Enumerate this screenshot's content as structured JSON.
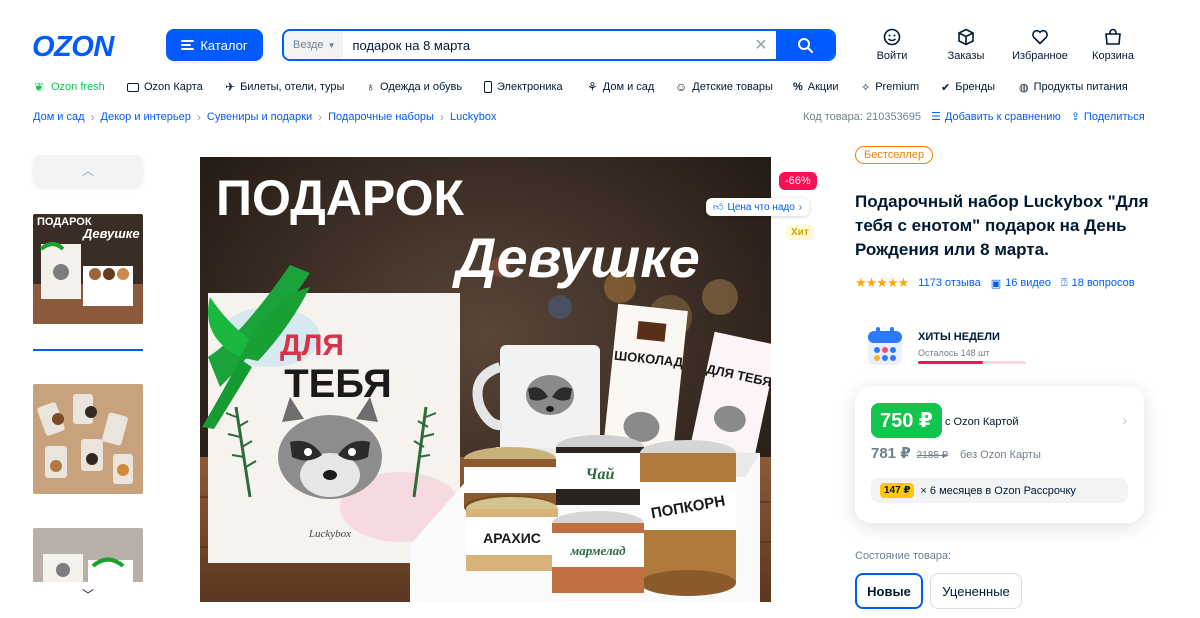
{
  "brand": {
    "logo": "OZON",
    "color": "#005bff"
  },
  "header": {
    "catalog_label": "Каталог",
    "search": {
      "scope": "Везде",
      "query": "подарок на 8 марта"
    },
    "icons": [
      {
        "name": "login-icon",
        "label": "Войти"
      },
      {
        "name": "orders-icon",
        "label": "Заказы"
      },
      {
        "name": "favorites-icon",
        "label": "Избранное"
      },
      {
        "name": "cart-icon",
        "label": "Корзина"
      }
    ]
  },
  "nav": [
    {
      "label": "Ozon fresh",
      "icon": "fresh-icon"
    },
    {
      "label": "Ozon Карта",
      "icon": "card-icon"
    },
    {
      "label": "Билеты, отели, туры",
      "icon": "plane-icon"
    },
    {
      "label": "Одежда и обувь",
      "icon": "clothes-icon"
    },
    {
      "label": "Электроника",
      "icon": "phone-icon"
    },
    {
      "label": "Дом и сад",
      "icon": "plant-icon"
    },
    {
      "label": "Детские товары",
      "icon": "kids-icon"
    },
    {
      "label": "Акции",
      "icon": "percent-icon"
    },
    {
      "label": "Premium",
      "icon": "premium-icon"
    },
    {
      "label": "Бренды",
      "icon": "brands-icon"
    },
    {
      "label": "Продукты питания",
      "icon": "food-icon"
    }
  ],
  "breadcrumbs": [
    "Дом и сад",
    "Декор и интерьер",
    "Сувениры и подарки",
    "Подарочные наборы",
    "Luckybox"
  ],
  "meta": {
    "code": "Код товара: 210353695",
    "compare": "Добавить к сравнению",
    "share": "Поделиться"
  },
  "image": {
    "headline_1": "ПОДАРОК",
    "headline_2": "Девушке",
    "box_1": "ДЛЯ",
    "box_2": "ТЕБЯ",
    "box_brand": "Luckybox",
    "jar_1": "ПОПКОРН",
    "jar_2": "Чай",
    "jar_3": "АРАХИС",
    "jar_4": "мармелад",
    "pack_1": "ШОКОЛАД",
    "pack_2": "ДЛЯ ТЕБЯ",
    "thumb_text_1": "ПОДАРОК",
    "thumb_text_2": "Девушке"
  },
  "badges": {
    "discount": "-66%",
    "price_link": "Цена что надо",
    "hit": "Хит"
  },
  "product": {
    "bestseller": "Бестселлер",
    "title": "Подарочный набор Luckybox \"Для тебя с енотом\" подарок на День Рождения или 8 марта.",
    "reviews": "1173 отзыва",
    "videos": "16 видео",
    "questions": "18 вопросов",
    "rating": 5,
    "week_title": "ХИТЫ НЕДЕЛИ",
    "week_sub": "Осталось 148 шт",
    "week_progress": 0.6
  },
  "price": {
    "card_price": "750 ₽",
    "card_label": "с Ozon Картой",
    "price": "781 ₽",
    "old_price": "2185 ₽",
    "no_card_label": "без Ozon Карты",
    "installment_badge": "147 ₽",
    "installment_text": "× 6 месяцев в Ozon Рассрочку"
  },
  "condition": {
    "label": "Состояние товара:",
    "options": [
      "Новые",
      "Уцененные"
    ],
    "selected": "Новые"
  }
}
